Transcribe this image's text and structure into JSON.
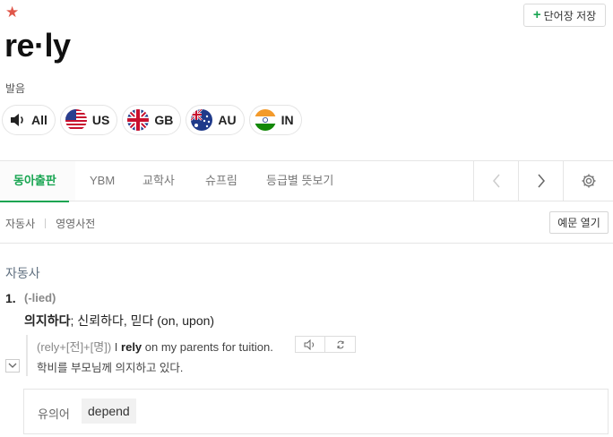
{
  "header": {
    "star_icon": "star-icon",
    "save_button": "단어장 저장",
    "word": "re·ly",
    "pronunciation_label": "발음"
  },
  "pronunciation": {
    "buttons": [
      {
        "label": "All",
        "icon": "speaker-icon"
      },
      {
        "label": "US",
        "icon": "us-flag-icon"
      },
      {
        "label": "GB",
        "icon": "gb-flag-icon"
      },
      {
        "label": "AU",
        "icon": "au-flag-icon"
      },
      {
        "label": "IN",
        "icon": "in-flag-icon"
      }
    ]
  },
  "tabs": {
    "items": [
      "동아출판",
      "YBM",
      "교학사",
      "슈프림",
      "등급별 뜻보기"
    ],
    "active": "동아출판",
    "accent_color": "#19a552"
  },
  "filter": {
    "items": [
      "자동사",
      "영영사전"
    ],
    "example_button": "예문 열기"
  },
  "entry": {
    "part_of_speech": "자동사",
    "senses": [
      {
        "number": "1.",
        "form": "(-lied)",
        "definition_bold": "의지하다",
        "definition_rest": "; 신뢰하다, 믿다 (on, upon)",
        "example": {
          "tag": "(rely+[전]+[명])",
          "pre": "I ",
          "keyword": "rely",
          "post": " on my parents for tuition.",
          "translation": "학비를 부모님께 의지하고 있다."
        }
      }
    ],
    "synonym_label": "유의어",
    "synonym": "depend"
  }
}
